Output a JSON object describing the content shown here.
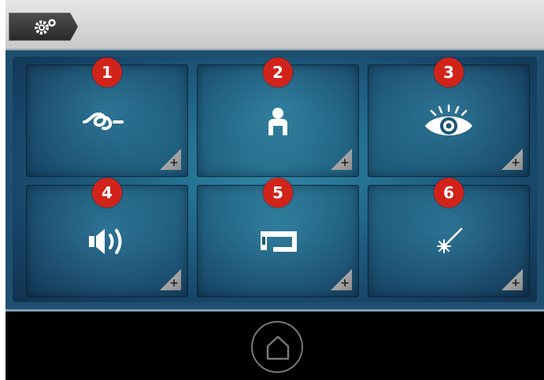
{
  "header": {
    "settings_icon": "gears-icon"
  },
  "tiles": [
    {
      "number": "1",
      "icon": "knot-icon"
    },
    {
      "number": "2",
      "icon": "user-icon"
    },
    {
      "number": "3",
      "icon": "eye-icon"
    },
    {
      "number": "4",
      "icon": "speaker-icon"
    },
    {
      "number": "5",
      "icon": "sewing-machine-icon"
    },
    {
      "number": "6",
      "icon": "light-icon"
    }
  ],
  "tile_corner_label": "+",
  "footer": {
    "home_icon": "home-icon"
  },
  "colors": {
    "badge": "#d2231a",
    "screen_background": "#1f4f6f",
    "topbar": "#d6d6d6",
    "device_bezel": "#000000"
  }
}
